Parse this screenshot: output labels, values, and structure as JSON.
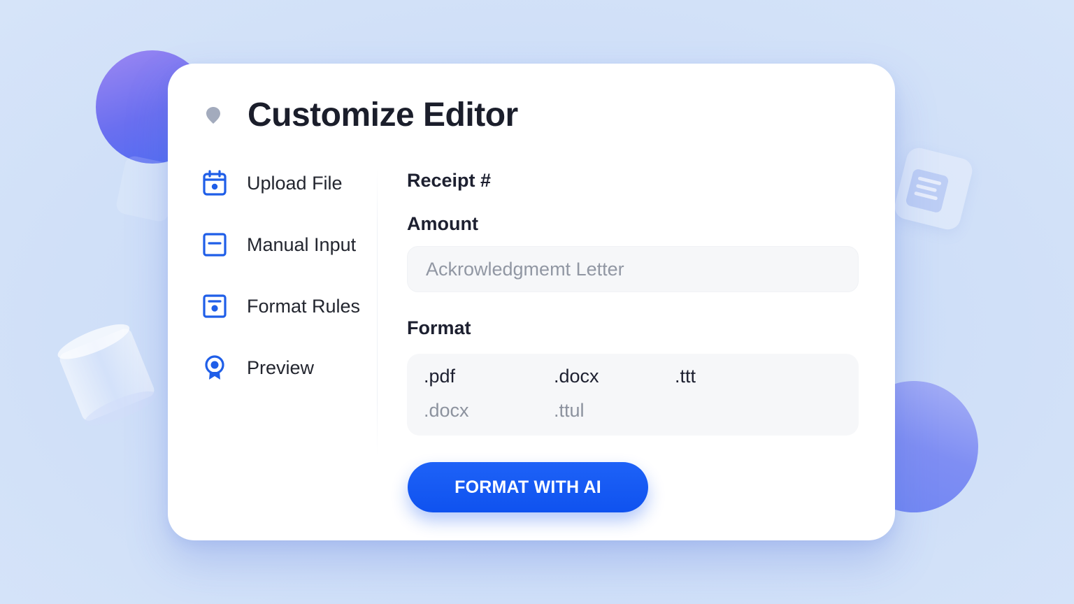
{
  "header": {
    "title": "Customize Editor",
    "icon": "map-pin-icon"
  },
  "sidebar": {
    "items": [
      {
        "label": "Upload File",
        "icon": "calendar-icon"
      },
      {
        "label": "Manual Input",
        "icon": "input-box-icon"
      },
      {
        "label": "Format Rules",
        "icon": "document-icon"
      },
      {
        "label": "Preview",
        "icon": "location-pin-icon"
      }
    ]
  },
  "form": {
    "receipt_label": "Receipt #",
    "amount_label": "Amount",
    "amount_value": "Ackrowledgmemt Letter",
    "format_label": "Format",
    "format_options_primary": [
      ".pdf",
      ".docx",
      ".ttt"
    ],
    "format_options_secondary": [
      ".docx",
      ".ttul"
    ],
    "submit_label": "FORMAT WITH AI"
  },
  "colors": {
    "accent": "#1458f0",
    "background": "#cfdff8",
    "card": "#ffffff",
    "title_text": "#1b1e2b",
    "muted_text": "#8c929e"
  }
}
